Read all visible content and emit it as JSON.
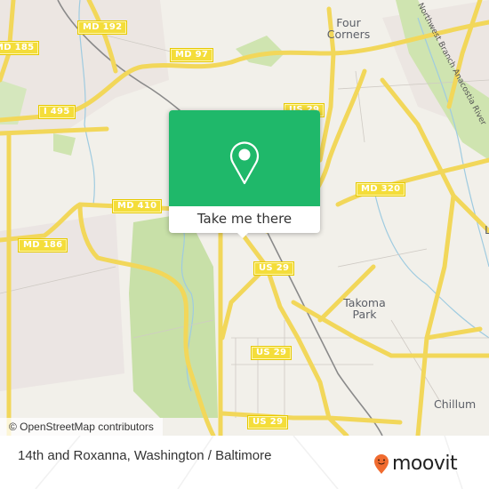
{
  "map": {
    "shields": [
      {
        "label": "MD 192"
      },
      {
        "label": "MD 185"
      },
      {
        "label": "MD 97"
      },
      {
        "label": "I 495"
      },
      {
        "label": "US 29"
      },
      {
        "label": "MD 410"
      },
      {
        "label": "MD 186"
      },
      {
        "label": "MD 320"
      },
      {
        "label": "US 29"
      },
      {
        "label": "US 29"
      },
      {
        "label": "US 29"
      }
    ],
    "places": [
      {
        "label": "Four Corners"
      },
      {
        "label": "Takoma Park"
      },
      {
        "label": "Chillum"
      },
      {
        "label": "L"
      }
    ],
    "river_label": "Northwest Branch Anacostia River",
    "attribution": "© OpenStreetMap contributors",
    "colors": {
      "land": "#f2f0ea",
      "park": "#c8e0a8",
      "road": "#f7e06a",
      "water": "#9fcbe0",
      "popup": "#1fb86a",
      "brand": "#f06b2f"
    }
  },
  "popup": {
    "button_label": "Take me there"
  },
  "footer": {
    "title": "14th and Roxanna, Washington / Baltimore",
    "brand": "moovit"
  }
}
